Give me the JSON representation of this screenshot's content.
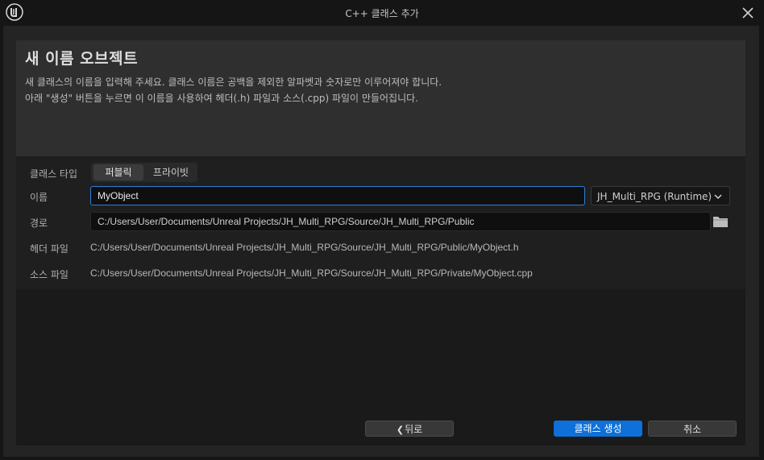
{
  "window": {
    "title": "C++ 클래스 추가",
    "logo_icon": "unreal-engine-logo",
    "close_icon": "close-icon"
  },
  "header": {
    "heading": "새 이름 오브젝트",
    "line1": "새 클래스의 이름을 입력해 주세요. 클래스 이름은 공백을 제외한 알파벳과 숫자로만 이루어져야 합니다.",
    "line2": "아래 \"생성\" 버튼을 누르면 이 이름을 사용하여 헤더(.h) 파일과 소스(.cpp) 파일이 만들어집니다."
  },
  "form": {
    "class_type_label": "클래스 타입",
    "class_type_options": [
      "퍼블릭",
      "프라이빗"
    ],
    "class_type_selected": "퍼블릭",
    "name_label": "이름",
    "name_value": "MyObject",
    "module_selected": "JH_Multi_RPG (Runtime)",
    "path_label": "경로",
    "path_value": "C:/Users/User/Documents/Unreal Projects/JH_Multi_RPG/Source/JH_Multi_RPG/Public",
    "header_file_label": "헤더 파일",
    "header_file_value": "C:/Users/User/Documents/Unreal Projects/JH_Multi_RPG/Source/JH_Multi_RPG/Public/MyObject.h",
    "source_file_label": "소스 파일",
    "source_file_value": "C:/Users/User/Documents/Unreal Projects/JH_Multi_RPG/Source/JH_Multi_RPG/Private/MyObject.cpp"
  },
  "buttons": {
    "back_label": "뒤로",
    "create_label": "클래스 생성",
    "cancel_label": "취소"
  },
  "colors": {
    "accent": "#0e70d8",
    "focus_border": "#2f7fd8"
  }
}
